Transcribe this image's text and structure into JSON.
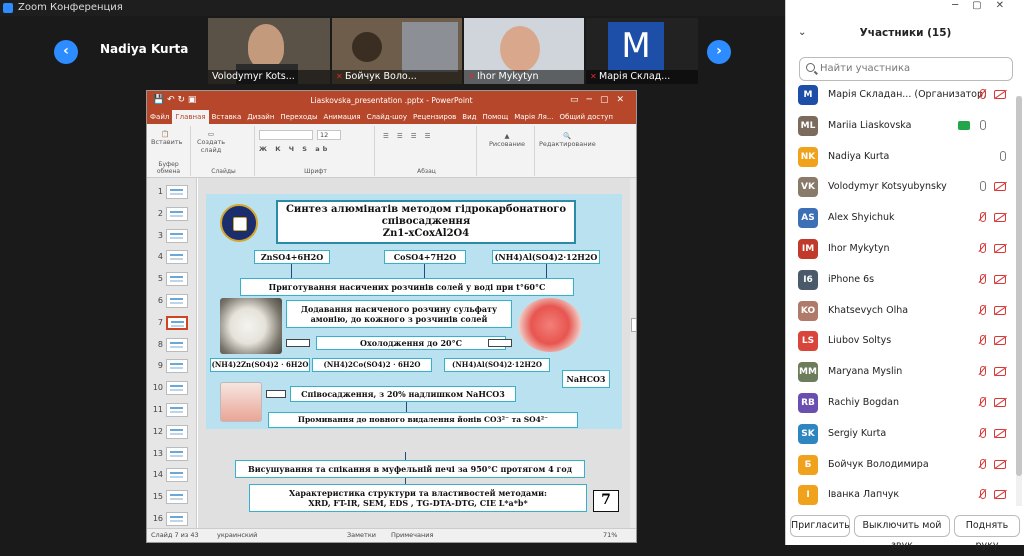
{
  "window": {
    "title": "Zoom Конференция"
  },
  "gallery": {
    "active_speaker_name": "Nadiya Kurta",
    "tiles": [
      {
        "name": "Volodymyr Kots...",
        "muted": false
      },
      {
        "name": "Бойчук Воло...",
        "muted": true
      },
      {
        "name": "Ihor Mykytyn",
        "muted": true
      },
      {
        "name": "Марія Склад...",
        "muted": true,
        "initial": "M"
      }
    ],
    "prev_label": "‹",
    "next_label": "›"
  },
  "ppt": {
    "title": "Liaskovska_presentation .pptx - PowerPoint",
    "tabs": [
      "Файл",
      "Главная",
      "Вставка",
      "Дизайн",
      "Переходы",
      "Анимация",
      "Слайд-шоу",
      "Рецензиров",
      "Вид",
      "Помощ",
      "Марія Ля...",
      "Общий доступ"
    ],
    "active_tab": "Главная",
    "ribbon": {
      "paste": "Вставить",
      "new_slide": "Создать слайд",
      "font_size": "12",
      "groups": [
        "Буфер обмена",
        "Слайды",
        "Шрифт",
        "Абзац",
        "Рисование",
        "Редактирование"
      ],
      "drawing": "Рисование",
      "editing": "Редактирование"
    },
    "thumbnails": [
      "1",
      "2",
      "3",
      "4",
      "5",
      "6",
      "7",
      "8",
      "9",
      "10",
      "11",
      "12",
      "13",
      "14",
      "15",
      "16"
    ],
    "selected_thumb": "7",
    "status": {
      "slide": "Слайд 7 из 43",
      "lang": "украинский",
      "notes": "Заметки",
      "comments": "Примечания",
      "zoom": "71%"
    }
  },
  "slide": {
    "title_line1": "Синтез алюмінатів методом  гідрокарбонатного",
    "title_line2": "співосадження",
    "title_formula": "Zn1-xCoxAl2O4",
    "salt1": "ZnSO4+6H2O",
    "salt2": "CoSO4+7H2O",
    "salt3": "(NH4)Al(SO4)2·12H2O",
    "step1": "Приготування насичених розчинів солей у воді при t°60°C",
    "step2": "Додавання насиченого розчину сульфату амонію, до кожного з розчинів солей",
    "step3": "Охолодження до 20°C",
    "prod1": "(NH4)2Zn(SO4)2 · 6H2O",
    "prod2": "(NH4)2Co(SO4)2 · 6H2O",
    "prod3": "(NH4)Al(SO4)2·12H2O",
    "reagent": "NaHCO3",
    "step4": "Співосадження, з 20% надлишком NaHCO3",
    "step5": "Промивання  до повного видалення йонів CO3²⁻ та SO4²⁻",
    "step6": "Висушування та спікання в муфельній печі за  950°C  протягом 4 год",
    "step7_line1": "Характеристика структури  та властивостей методами:",
    "step7_line2": "XRD, FT-IR, SEM, EDS , TG-DTA-DTG, CIE L*a*b*",
    "number": "7"
  },
  "panel": {
    "header": "Участники (15)",
    "search_placeholder": "Найти участника",
    "participants": [
      {
        "initials": "M",
        "color": "#1e4fa8",
        "name": "Марія Складан...  (Организатор)",
        "mic": "muted",
        "cam": "off"
      },
      {
        "initials": "ML",
        "color": "#7a6b5d",
        "name": "Mariia Liaskovska",
        "mic": "on",
        "cam": "on"
      },
      {
        "initials": "NK",
        "color": "#f0a21c",
        "name": "Nadiya Kurta",
        "mic": "on",
        "cam": "none"
      },
      {
        "initials": "VK",
        "color": "#8a7a6a",
        "name": "Volodymyr Kotsyubynsky",
        "mic": "on",
        "cam": "off"
      },
      {
        "initials": "AS",
        "color": "#3c6fb5",
        "name": "Alex Shyichuk",
        "mic": "muted",
        "cam": "off"
      },
      {
        "initials": "IM",
        "color": "#c0392b",
        "name": "Ihor Mykytyn",
        "mic": "muted",
        "cam": "off"
      },
      {
        "initials": "I6",
        "color": "#4a5a6a",
        "name": "iPhone 6s",
        "mic": "muted",
        "cam": "off"
      },
      {
        "initials": "KO",
        "color": "#b07a6a",
        "name": "Khatsevych Olha",
        "mic": "muted",
        "cam": "off"
      },
      {
        "initials": "LS",
        "color": "#d9453b",
        "name": "Liubov Soltys",
        "mic": "muted",
        "cam": "off"
      },
      {
        "initials": "MM",
        "color": "#6b7d5a",
        "name": "Maryana Myslin",
        "mic": "muted",
        "cam": "off"
      },
      {
        "initials": "RB",
        "color": "#6a4fb0",
        "name": "Rachiy Bogdan",
        "mic": "muted",
        "cam": "off"
      },
      {
        "initials": "SK",
        "color": "#2e86c1",
        "name": "Sergiy Kurta",
        "mic": "muted",
        "cam": "off"
      },
      {
        "initials": "Б",
        "color": "#f0a21c",
        "name": "Бойчук Володимира",
        "mic": "muted",
        "cam": "off"
      },
      {
        "initials": "І",
        "color": "#f0a21c",
        "name": "Іванка Лапчук",
        "mic": "muted",
        "cam": "off"
      }
    ],
    "buttons": {
      "invite": "Пригласить",
      "mute": "Выключить мой звук",
      "raise": "Поднять руку"
    }
  }
}
